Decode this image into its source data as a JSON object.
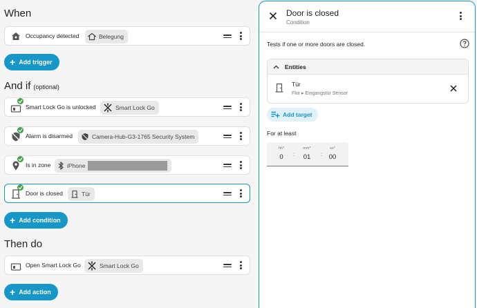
{
  "left": {
    "when": {
      "title": "When"
    },
    "triggers": [
      {
        "label": "Occupancy detected",
        "chip": "Belegung"
      }
    ],
    "add_trigger": "Add trigger",
    "and_if": {
      "title": "And if",
      "optional": "(optional)"
    },
    "conditions": [
      {
        "label": "Smart Lock Go is unlocked",
        "chip": "Smart Lock Go"
      },
      {
        "label": "Alarm is disarmed",
        "chip": "Camera-Hub-G3-1765 Security System"
      },
      {
        "label": "Is in zone",
        "chip": "iPhone"
      },
      {
        "label": "Door is closed",
        "chip": "Tür"
      }
    ],
    "add_condition": "Add condition",
    "then_do": {
      "title": "Then do"
    },
    "actions": [
      {
        "label": "Open Smart Lock Go",
        "chip": "Smart Lock Go"
      }
    ],
    "add_action": "Add action"
  },
  "panel": {
    "title": "Door is closed",
    "subtitle": "Condition",
    "description": "Tests if one or more doors are closed.",
    "entities_header": "Entities",
    "entity": {
      "name": "Tür",
      "area": "Flur",
      "device": "Eingangstür Sensor"
    },
    "add_target": "Add target",
    "for_at_least": "For at least",
    "duration": {
      "hours_label": "hh*",
      "hours": "0",
      "minutes_label": "mm*",
      "minutes": "01",
      "seconds_label": "ss*",
      "seconds": "00"
    }
  },
  "colors": {
    "accent": "#1796c8",
    "check": "#43a047"
  }
}
